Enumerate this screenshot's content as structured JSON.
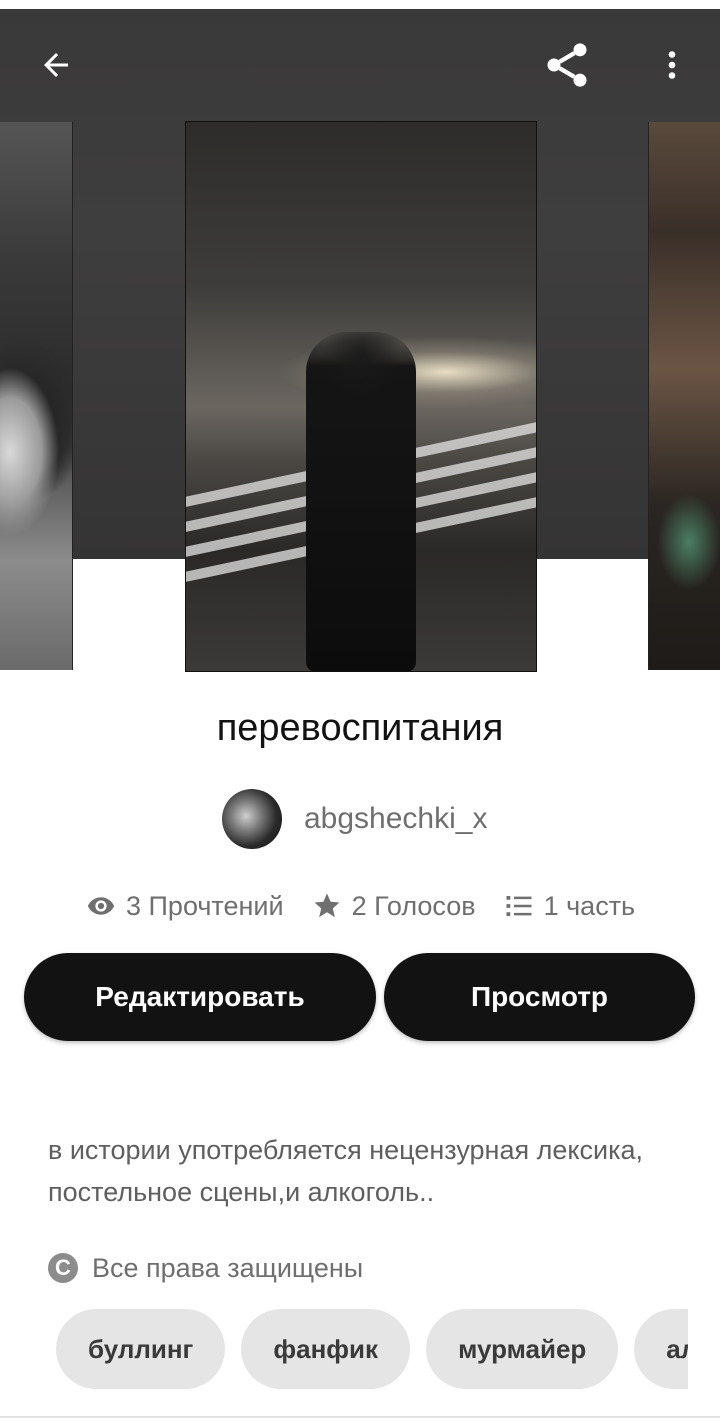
{
  "header": {
    "back_icon": "arrow-left-icon",
    "share_icon": "share-icon",
    "more_icon": "more-vertical-icon"
  },
  "story": {
    "title": "перевоспитания",
    "author": "abgshechki_x",
    "stats": {
      "reads": "3 Прочтений",
      "votes": "2 Голосов",
      "parts": "1 часть"
    }
  },
  "actions": {
    "edit_label": "Редактировать",
    "view_label": "Просмотр"
  },
  "description": "в истории употребляется нецензурная лексика, постельное сцены,и алкоголь..",
  "rights": "Все права защищены",
  "tags": [
    "буллинг",
    "фанфик",
    "мурмайер",
    "алкоголь"
  ],
  "colors": {
    "button_bg": "#121212",
    "header_bg": "#3a3939",
    "tag_bg": "#e6e5e5"
  }
}
